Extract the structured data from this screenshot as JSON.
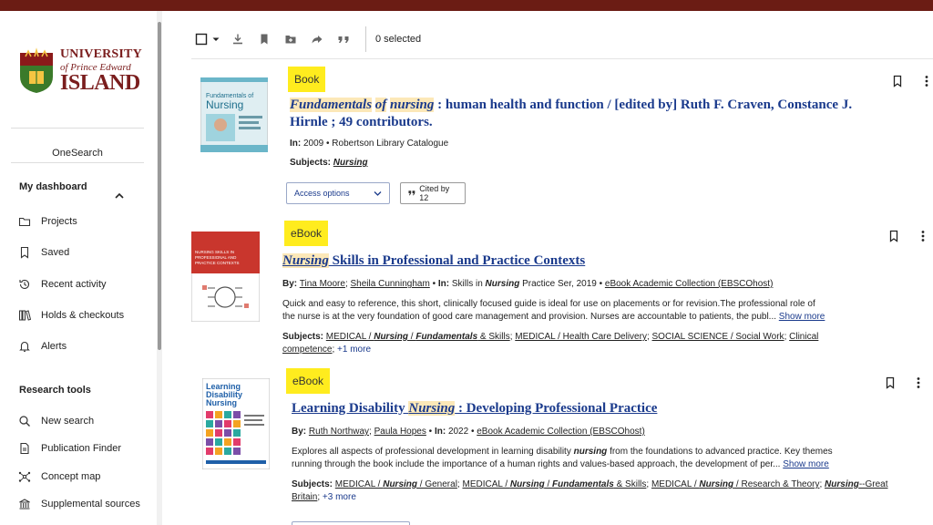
{
  "brand": {
    "line1": "UNIVERSITY",
    "line2": "of Prince Edward",
    "line3": "ISLAND",
    "color": "#7a1d1d"
  },
  "sidebar": {
    "onesearch": "OneSearch",
    "dashboard_title": "My dashboard",
    "dashboard_items": [
      {
        "label": "Projects",
        "icon": "folder-icon"
      },
      {
        "label": "Saved",
        "icon": "bookmark-icon"
      },
      {
        "label": "Recent activity",
        "icon": "history-icon"
      },
      {
        "label": "Holds & checkouts",
        "icon": "books-icon"
      },
      {
        "label": "Alerts",
        "icon": "bell-icon"
      }
    ],
    "research_title": "Research tools",
    "research_items": [
      {
        "label": "New search",
        "icon": "search-icon"
      },
      {
        "label": "Publication Finder",
        "icon": "document-icon"
      },
      {
        "label": "Concept map",
        "icon": "concept-map-icon"
      },
      {
        "label": "Supplemental sources",
        "icon": "institution-icon"
      }
    ]
  },
  "toolbar": {
    "selected": "0 selected"
  },
  "results": [
    {
      "type": "Book",
      "title_parts": [
        "Fundamentals",
        " ",
        "of",
        " ",
        "nursing",
        " : human health and function / [edited by] Ruth F. Craven, Constance J. Hirnle ; 49 contributors."
      ],
      "meta_in_label": "In:",
      "meta_rest": "2009 • Robertson Library Catalogue",
      "subjects_label": "Subjects:",
      "subjects": "Nursing",
      "access_label": "Access options",
      "cited_label": "Cited by 12",
      "cover_text": "Fundamentals of Nursing"
    },
    {
      "type": "eBook",
      "title_hl": "Nursing",
      "title_rest": " Skills in Professional and Practice Contexts",
      "by_label": "By:",
      "author1": "Tina Moore",
      "author2": "Sheila Cunningham",
      "in_label": "In:",
      "in_pre": "Skills in ",
      "in_hl": "Nursing",
      "in_post": " Practice Ser, 2019 • ",
      "source": "eBook Academic Collection (EBSCOhost)",
      "abstract_line1": "Quick and easy to reference, this short, clinically focused guide is ideal for use on placements or for revision.The professional role of",
      "abstract_line2": "the nurse is at the very foundation of good care management and provision. Nurses are accountable to patients, the publ...",
      "show_more": "Show more",
      "subjects_label": "Subjects:",
      "subj_1a": "MEDICAL / ",
      "subj_1b": "Nursing",
      "subj_1c": " / ",
      "subj_1d": "Fundamentals",
      "subj_1e": " & Skills",
      "subj_2": "MEDICAL / Health Care Delivery",
      "subj_3": "SOCIAL SCIENCE / Social Work",
      "subj_4": "Clinical competence",
      "subj_more": "+1 more",
      "cover_text": "NURSING SKILLS IN PROFESSIONAL AND PRACTICE CONTEXTS"
    },
    {
      "type": "eBook",
      "title_pre": "Learning Disability ",
      "title_hl": "Nursing",
      "title_rest": " : Developing Professional Practice",
      "by_label": "By:",
      "author1": "Ruth Northway",
      "author2": "Paula Hopes",
      "in_label": "In:",
      "in_rest": "2022 • ",
      "source": "eBook Academic Collection (EBSCOhost)",
      "abstract_line1_pre": "Explores all aspects of professional development in learning disability ",
      "abstract_line1_hl": "nursing",
      "abstract_line1_post": " from the foundations to advanced practice. Key themes",
      "abstract_line2": "running through the book include the importance of a human rights and values-based approach, the development of per...",
      "show_more": "Show more",
      "subjects_label": "Subjects:",
      "subj_1a": "MEDICAL / ",
      "subj_1b": "Nursing",
      "subj_1c": " / General",
      "subj_2a": "MEDICAL / ",
      "subj_2b": "Nursing",
      "subj_2c": " / ",
      "subj_2d": "Fundamentals",
      "subj_2e": " & Skills",
      "subj_3a": "MEDICAL / ",
      "subj_3b": "Nursing",
      "subj_3c": " / Research & Theory",
      "subj_4a": "Nursing",
      "subj_4b": "--Great Britain",
      "subj_more": "+3 more",
      "cover_text": "Learning Disability Nursing"
    }
  ],
  "colors": {
    "topbar": "#6b1c14",
    "link": "#1a3a8c",
    "badge": "#ffec1e",
    "highlight": "#fce8b8"
  }
}
